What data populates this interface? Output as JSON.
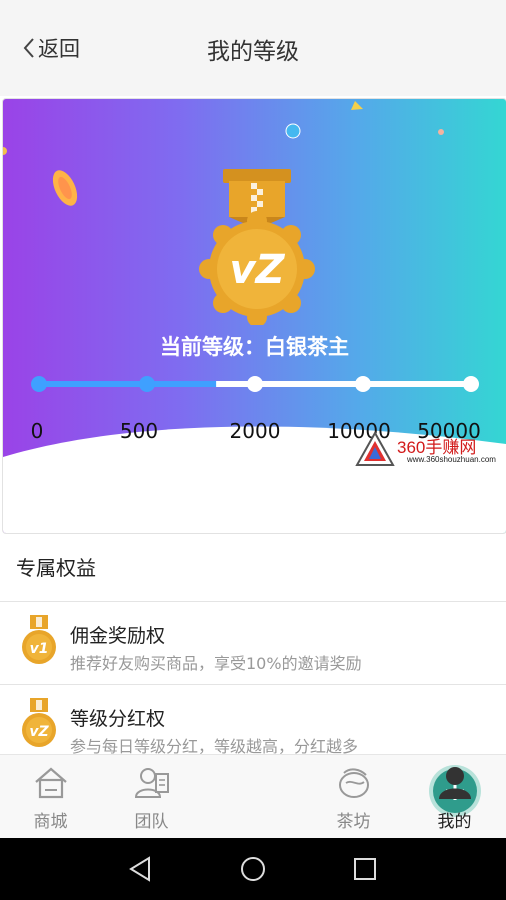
{
  "header": {
    "back_label": "返回",
    "title": "我的等级"
  },
  "banner": {
    "level_prefix": "当前等级：",
    "level_name": "白银茶主",
    "medal_text": "vZ",
    "progress": {
      "ticks": [
        "0",
        "500",
        "2000",
        "10000",
        "50000"
      ],
      "active_tick_count": 2,
      "fill_fraction": 0.41,
      "filled_color": "#3fa0ff",
      "track_color": "#ffffff"
    },
    "watermark": {
      "title": "360手赚网",
      "url": "www.360shouzhuan.com"
    }
  },
  "benefits": {
    "title": "专属权益",
    "items": [
      {
        "name": "佣金奖励权",
        "desc": "推荐好友购买商品，享受10%的邀请奖励",
        "icon": "medal-v1-icon",
        "badge": "v1"
      },
      {
        "name": "等级分红权",
        "desc": "参与每日等级分红，等级越高，分红越多",
        "icon": "medal-vz-icon",
        "badge": "vZ"
      }
    ]
  },
  "tabbar": {
    "items": [
      {
        "label": "商城",
        "icon": "shop-icon"
      },
      {
        "label": "团队",
        "icon": "team-icon"
      },
      {
        "label": "",
        "icon": "plus-icon"
      },
      {
        "label": "茶坊",
        "icon": "tea-icon"
      },
      {
        "label": "我的",
        "icon": "user-icon",
        "active": true
      }
    ]
  },
  "system_nav": {
    "buttons": [
      "back-triangle-icon",
      "home-circle-icon",
      "recents-square-icon"
    ]
  },
  "colors": {
    "accent_teal": "#2f9c8c",
    "gold": "#e8a52a",
    "gradient_start": "#9a43e7",
    "gradient_end": "#34d6d3"
  }
}
